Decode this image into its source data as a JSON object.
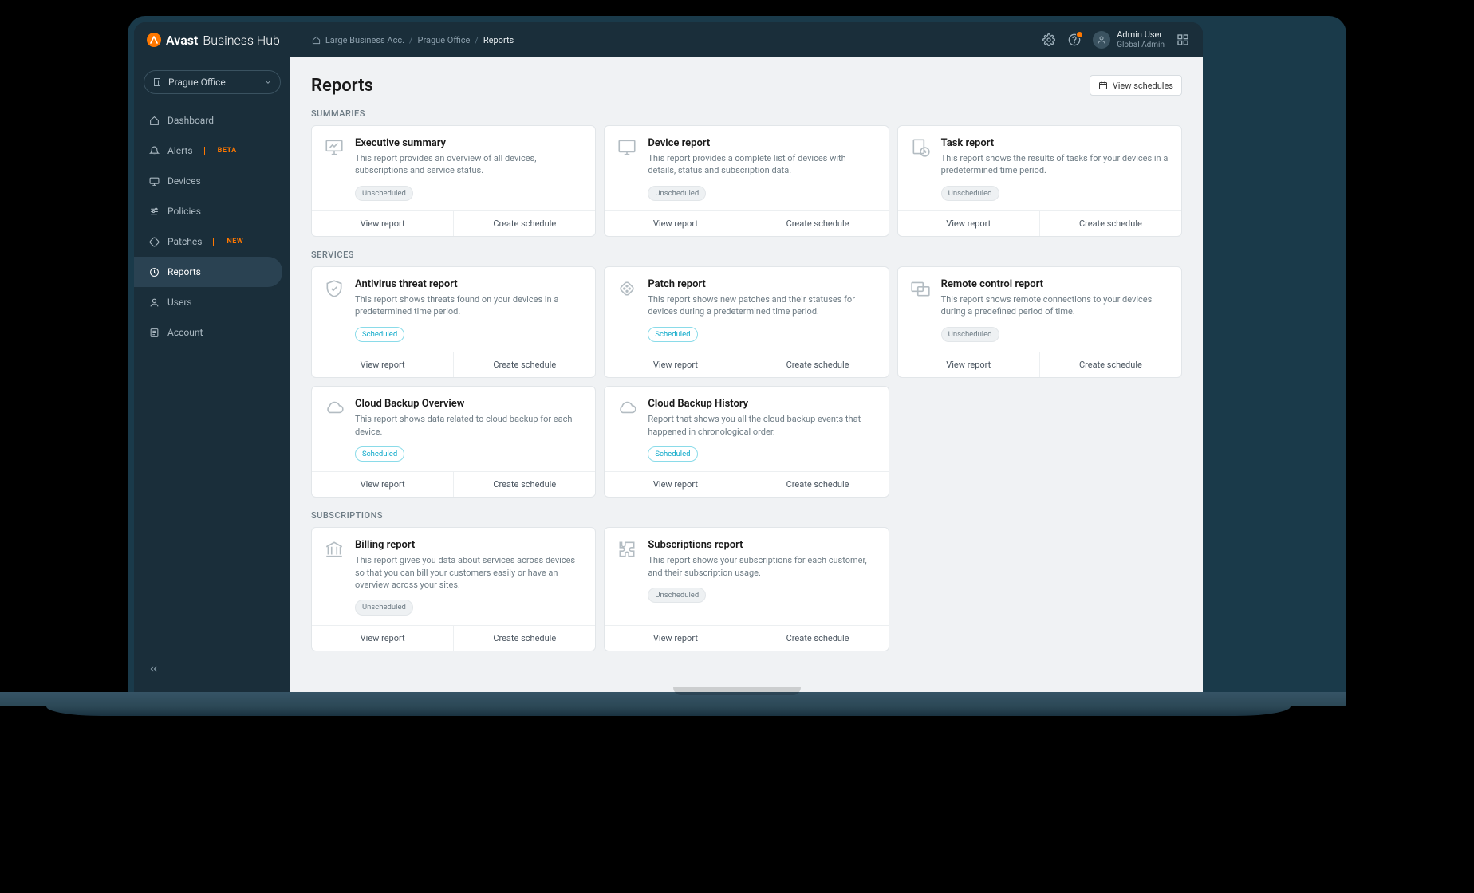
{
  "brand": {
    "strong": "Avast",
    "light": "Business Hub"
  },
  "breadcrumb": {
    "home": "Large Business Acc.",
    "site": "Prague Office",
    "current": "Reports"
  },
  "user": {
    "name": "Admin User",
    "role": "Global Admin"
  },
  "siteSelector": {
    "label": "Prague Office"
  },
  "nav": {
    "dashboard": "Dashboard",
    "alerts": "Alerts",
    "alerts_badge": "BETA",
    "devices": "Devices",
    "policies": "Policies",
    "patches": "Patches",
    "patches_badge": "NEW",
    "reports": "Reports",
    "users": "Users",
    "account": "Account"
  },
  "page": {
    "title": "Reports",
    "view_schedules": "View schedules",
    "sections": {
      "summaries": "SUMMARIES",
      "services": "SERVICES",
      "subscriptions": "SUBSCRIPTIONS"
    },
    "actions": {
      "view": "View report",
      "create": "Create schedule"
    },
    "pills": {
      "unscheduled": "Unscheduled",
      "scheduled": "Scheduled"
    }
  },
  "cards": {
    "exec": {
      "title": "Executive summary",
      "desc": "This report provides an overview of all devices, subscriptions and service status.",
      "status": "unscheduled"
    },
    "device": {
      "title": "Device report",
      "desc": "This report provides a complete list of devices with details, status and subscription data.",
      "status": "unscheduled"
    },
    "task": {
      "title": "Task report",
      "desc": "This report shows the results of tasks for your devices in a predetermined time period.",
      "status": "unscheduled"
    },
    "av": {
      "title": "Antivirus threat report",
      "desc": "This report shows threats found on your devices in a predetermined time period.",
      "status": "scheduled"
    },
    "patch": {
      "title": "Patch report",
      "desc": "This report shows new patches and their statuses for devices during a predetermined time period.",
      "status": "scheduled"
    },
    "remote": {
      "title": "Remote control report",
      "desc": "This report shows remote connections to your devices during a predefined period of time.",
      "status": "unscheduled"
    },
    "cboverview": {
      "title": "Cloud Backup Overview",
      "desc": "This report shows data related to cloud backup for each device.",
      "status": "scheduled"
    },
    "cbhistory": {
      "title": "Cloud Backup History",
      "desc": "Report that shows you all the cloud backup events that happened in chronological order.",
      "status": "scheduled"
    },
    "billing": {
      "title": "Billing report",
      "desc": "This report gives you data about services across devices so that you can bill your customers easily or have an overview across your sites.",
      "status": "unscheduled"
    },
    "subs": {
      "title": "Subscriptions report",
      "desc": "This report shows your subscriptions for each customer, and their subscription usage.",
      "status": "unscheduled"
    }
  }
}
